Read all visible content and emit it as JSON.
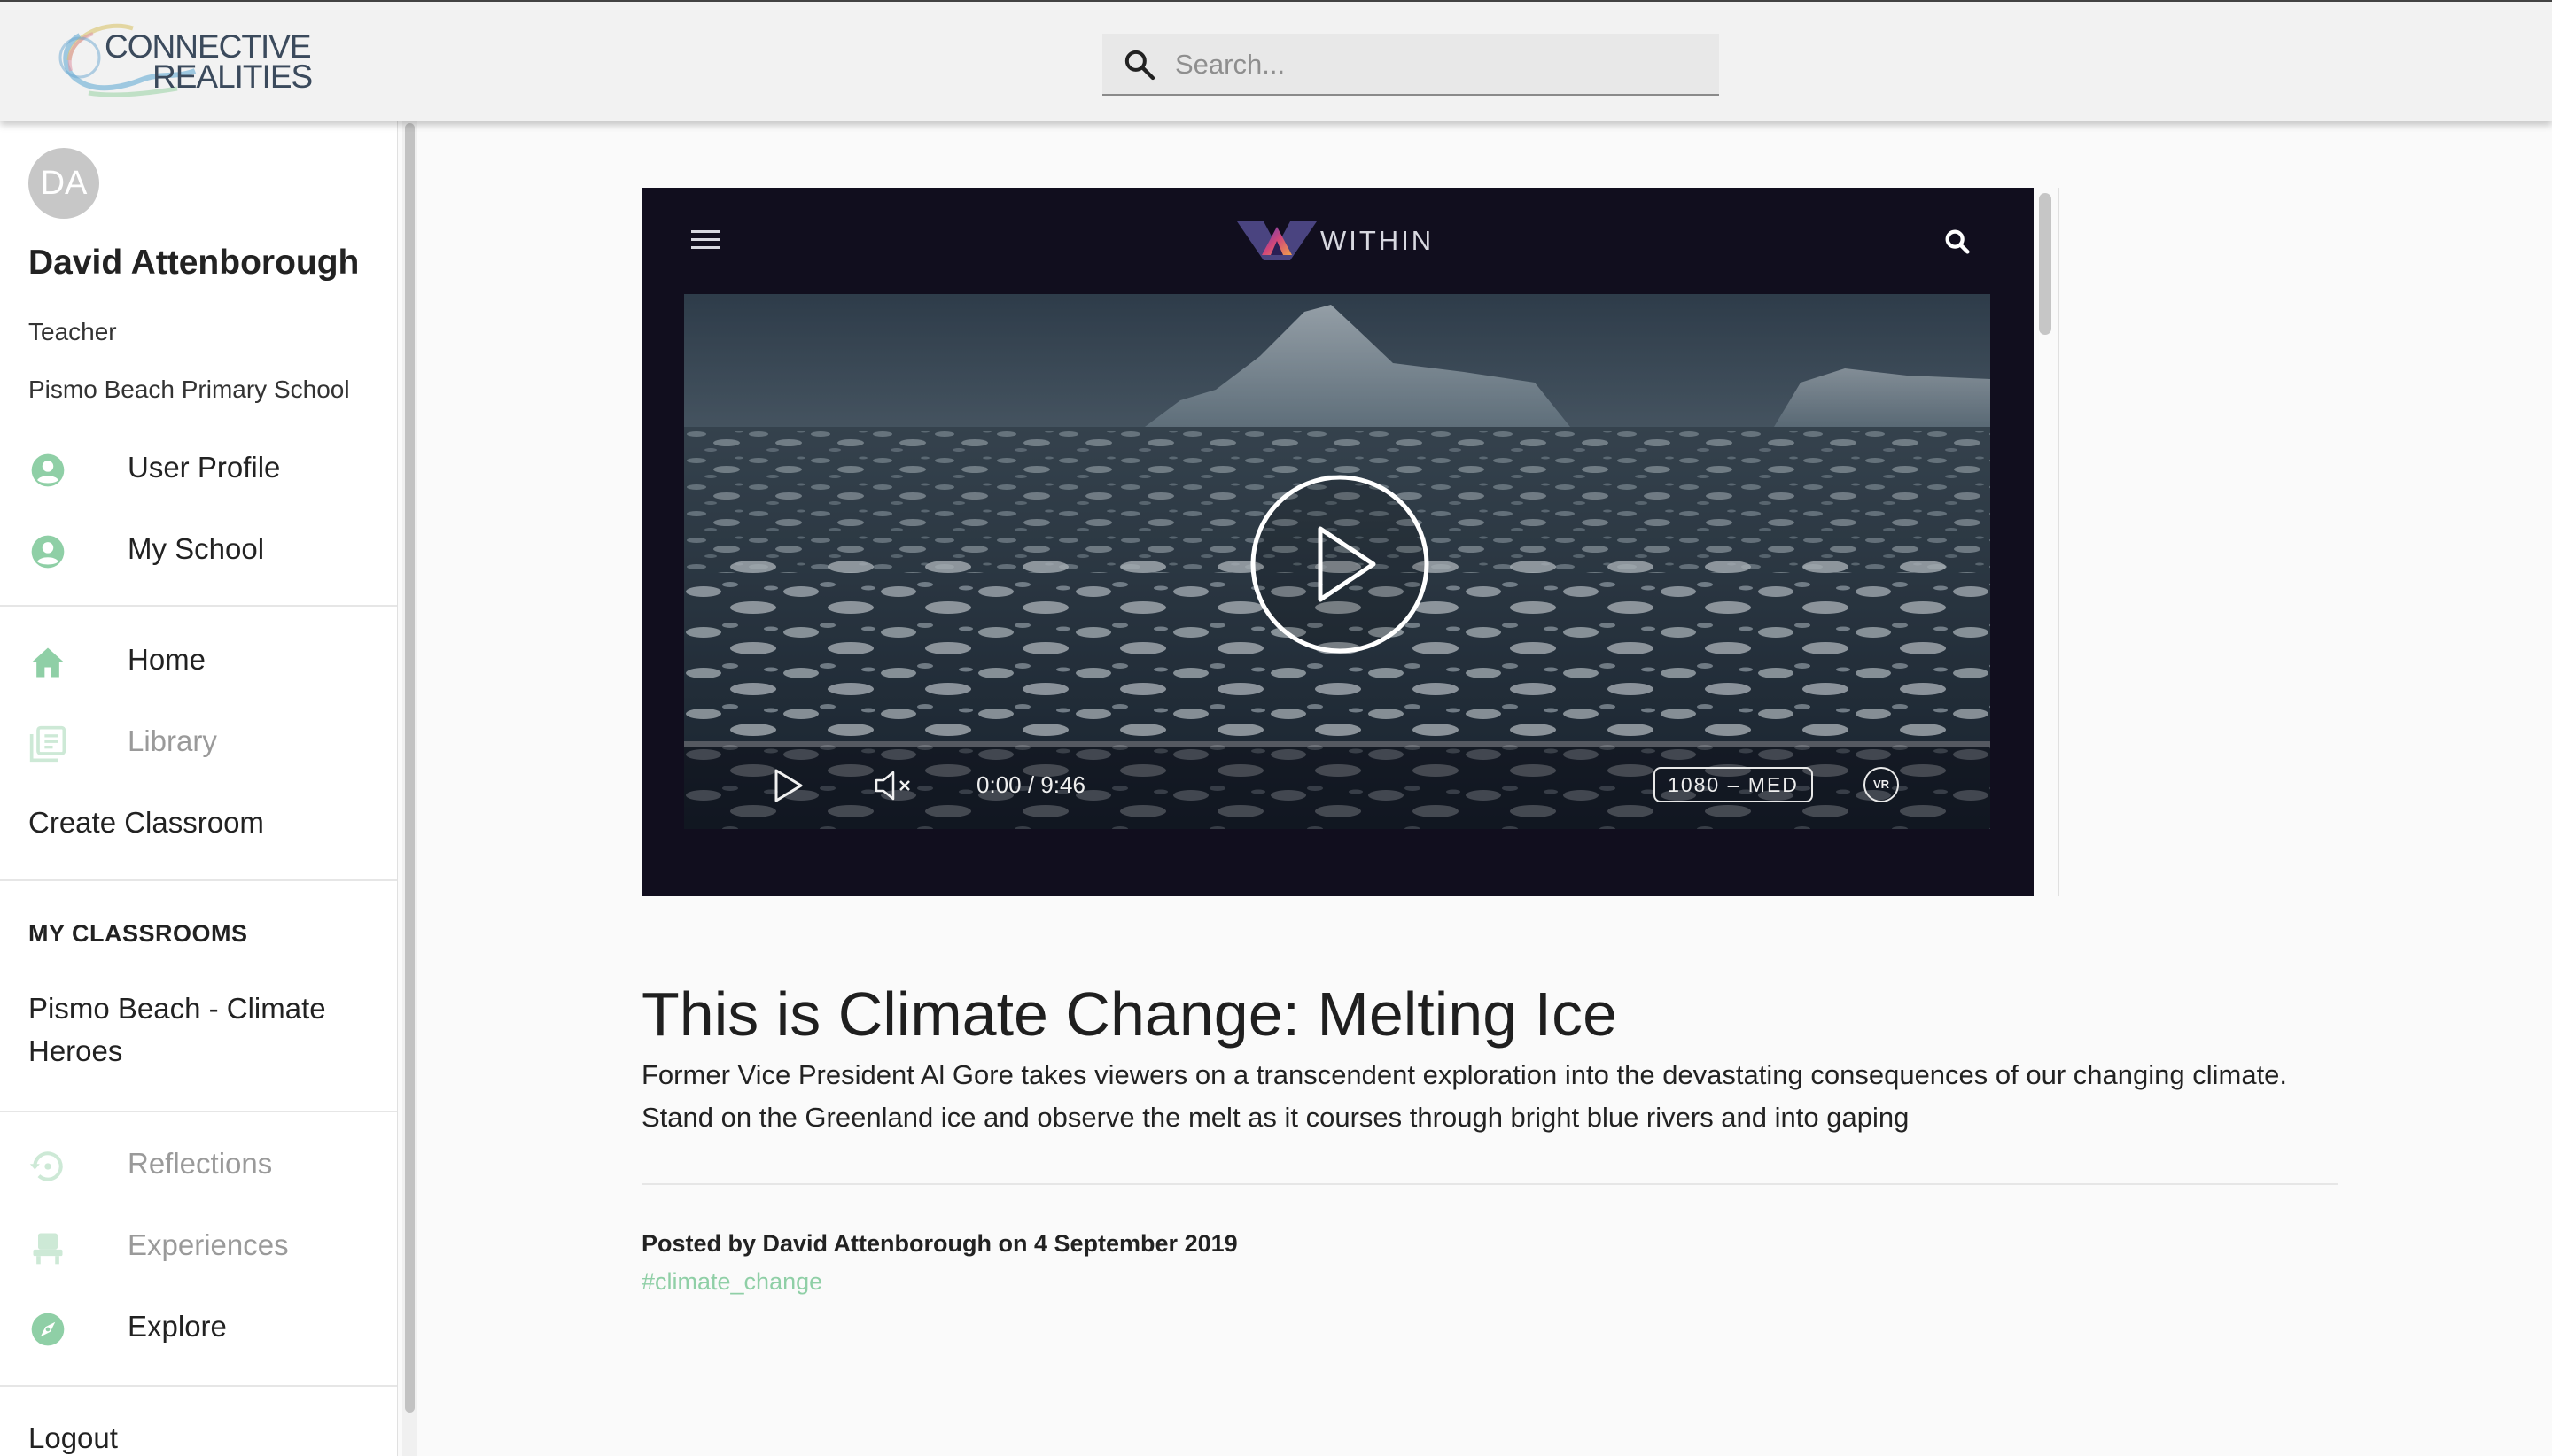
{
  "app": {
    "logo_line1": "CONNECTIVE",
    "logo_line2": "REALITIES",
    "search_placeholder": "Search..."
  },
  "user": {
    "initials": "DA",
    "name": "David Attenborough",
    "role": "Teacher",
    "school": "Pismo Beach Primary School"
  },
  "sidebar": {
    "account_items": [
      {
        "label": "User Profile",
        "icon": "account-circle-icon"
      },
      {
        "label": "My School",
        "icon": "account-circle-icon"
      }
    ],
    "nav_items": [
      {
        "label": "Home",
        "icon": "home-icon",
        "enabled": true
      },
      {
        "label": "Library",
        "icon": "library-icon",
        "enabled": false
      },
      {
        "label": "Create Classroom",
        "enabled": true
      }
    ],
    "classrooms_heading": "MY CLASSROOMS",
    "classrooms": [
      "Pismo Beach - Climate Heroes"
    ],
    "tool_items": [
      {
        "label": "Reflections",
        "icon": "history-icon",
        "enabled": false
      },
      {
        "label": "Experiences",
        "icon": "seat-icon",
        "enabled": false
      },
      {
        "label": "Explore",
        "icon": "compass-icon",
        "enabled": true
      }
    ],
    "logout_label": "Logout"
  },
  "player": {
    "brand": "WITHIN",
    "current_time": "0:00",
    "separator": "/",
    "duration": "9:46",
    "quality": "1080 – MED",
    "vr_label": "VR",
    "progress": 0.0
  },
  "experience": {
    "title": "This is Climate Change: Melting Ice",
    "description": "Former Vice President Al Gore takes viewers on a transcendent exploration into the devastating consequences of our changing climate. Stand on the Greenland ice and observe the melt as it courses through bright blue rivers and into gaping",
    "posted_by": "Posted by David Attenborough on 4 September 2019",
    "hashtag": "#climate_change"
  },
  "colors": {
    "accent_green": "#8fcfa6",
    "icon_green": "#8fcfa6",
    "player_bg": "#110e1e",
    "topbar_bg": "#f2f2f2"
  }
}
